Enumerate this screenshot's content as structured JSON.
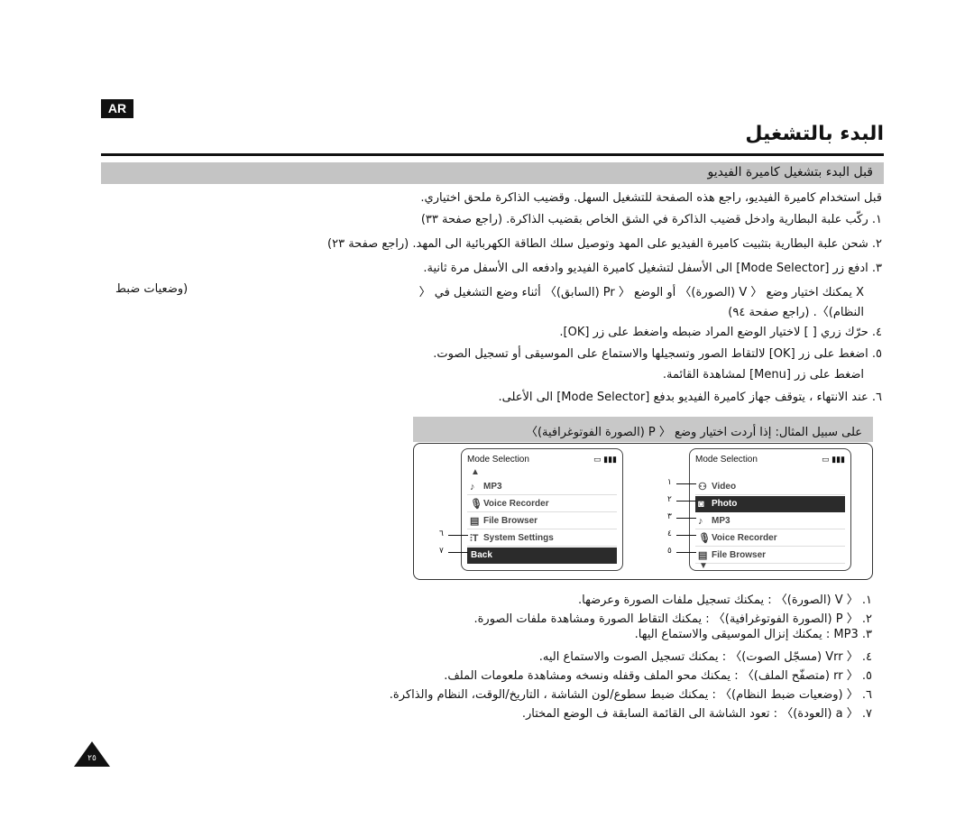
{
  "badge": "AR",
  "title": "البدء بالتشغيل",
  "section_title": "قبل البدء بتشغيل كاميرة الفيديو",
  "intro": "قبل استخدام كاميرة الفيديو، راجع هذه الصفحة للتشغيل السهل. وقضيب الذاكرة ملحق اختياري.",
  "steps": [
    "١. ركّب علبة البطارية وادخل قضيب الذاكرة في الشق الخاص بقضيب الذاكرة. (راجع صفحة ٣٣)",
    "٢. شحن علبة البطارية بتثبيت كاميرة الفيديو على المهد وتوصيل سلك الطاقة الكهربائية الى المهد. (راجع صفحة ٢٣)",
    "٣. ادفع زر [Mode Selector] الى الأسفل لتشغيل كاميرة الفيديو وادفعه الى الأسفل مرة ثانية.",
    "٤. حرّك زري [ ] لاختيار الوضع المراد ضبطه واضغط على زر [OK].",
    "٥. اضغط على زر [OK] لالتقاط الصور وتسجيلها والاستماع على الموسيقى أو تسجيل الصوت.",
    "٦. عند الانتهاء ، يتوقف جهاز كاميرة الفيديو بدفع [Mode Selector] الى الأعلى."
  ],
  "note_main": "X  يمكنك اختيار وضع 〈  V (الصورة)〉 أو الوضع 〈  Pr (السابق)〉 أثناء وضع التشغيل في 〈",
  "note_left": "(وضعيات ضبط",
  "note_cont": "النظام)〉. (راجع صفحة ٩٤)",
  "menu_line": "اضغط على زر [Menu] لمشاهدة القائمة.",
  "example": "على سبيل المثال: إذا أردت اختيار وضع 〈  P (الصورة الفوتوغرافية)〉",
  "screens": {
    "header": "Mode Selection",
    "left_items": [
      {
        "label": "MP3",
        "icon": "music-note"
      },
      {
        "label": "Voice Recorder",
        "icon": "microphone"
      },
      {
        "label": "File Browser",
        "icon": "document"
      },
      {
        "label": "System Settings",
        "icon": "settings",
        "callout": "٦"
      },
      {
        "label": "Back",
        "icon": "",
        "callout": "٧",
        "selected": true
      }
    ],
    "right_items": [
      {
        "label": "Video",
        "icon": "video-camera",
        "callout": "١"
      },
      {
        "label": "Photo",
        "icon": "camera",
        "callout": "٢",
        "selected": true
      },
      {
        "label": "MP3",
        "icon": "music-note",
        "callout": "٣"
      },
      {
        "label": "Voice Recorder",
        "icon": "microphone",
        "callout": "٤"
      },
      {
        "label": "File Browser",
        "icon": "document",
        "callout": "٥"
      }
    ]
  },
  "descriptions": [
    "١.  〈  V (الصورة)〉 : يمكنك تسجيل ملفات الصورة وعرضها.",
    "٢.  〈  P (الصورة الفوتوغرافية)〉 : يمكنك التقاط الصورة ومشاهدة ملفات الصورة.",
    "٣. MP3 : يمكنك إنزال الموسيقى والاستماع اليها.",
    "٤.  〈  Vrr (مسجّل الصوت)〉 : يمكنك تسجيل الصوت والاستماع اليه.",
    "٥.  〈  rr (متصفّح الملف)〉 : يمكنك محو الملف وقفله ونسخه ومشاهدة ملعومات الملف.",
    "٦.  〈  (وضعيات ضبط النظام)〉 : يمكنك ضبط سطوع/لون الشاشة ، التاريخ/الوقت، النظام والذاكرة.",
    "٧.  〈  a (العودة)〉 : تعود الشاشة الى القائمة السابقة ف الوضع المختار."
  ],
  "page_number": "٢٥"
}
